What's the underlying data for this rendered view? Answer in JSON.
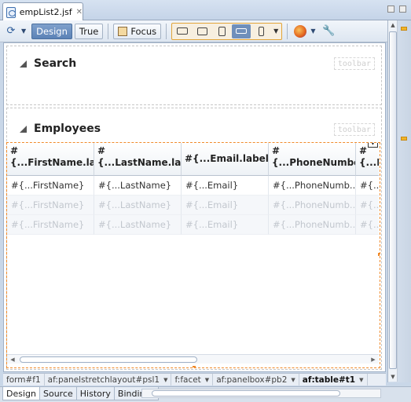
{
  "editor_tab": {
    "title": "empList2.jsf",
    "close_glyph": "✕"
  },
  "toolbar": {
    "design_label": "Design",
    "true_label": "True",
    "focus_label": "Focus",
    "dropdown_glyph": "▼",
    "selected_mode": "Design",
    "active_device": "wide-tablet"
  },
  "search_panel": {
    "title": "Search",
    "toolbar_placeholder": "toolbar"
  },
  "employees_panel": {
    "title": "Employees",
    "toolbar_placeholder": "toolbar"
  },
  "table": {
    "headers": [
      {
        "lines": [
          "#",
          "{...FirstName.label"
        ]
      },
      {
        "lines": [
          "#",
          "{...LastName.label"
        ]
      },
      {
        "lines": [
          "",
          "#{...Email.label}"
        ]
      },
      {
        "lines": [
          "#",
          "{...PhoneNumber"
        ]
      },
      {
        "lines": [
          "#",
          "{...H"
        ]
      }
    ],
    "rows": [
      [
        "#{...FirstName}",
        "#{...LastName}",
        "#{...Email}",
        "#{...PhoneNumb...",
        "#{...b"
      ],
      [
        "#{...FirstName}",
        "#{...LastName}",
        "#{...Email}",
        "#{...PhoneNumb...",
        "#{...b"
      ],
      [
        "#{...FirstName}",
        "#{...LastName}",
        "#{...Email}",
        "#{...PhoneNumb...",
        "#{...b"
      ]
    ],
    "column_menu_glyph": "▼"
  },
  "breadcrumb": [
    {
      "label": "form#f1",
      "current": false
    },
    {
      "label": "af:panelstretchlayout#psl1",
      "current": false
    },
    {
      "label": "f:facet",
      "current": false
    },
    {
      "label": "af:panelbox#pb2",
      "current": false
    },
    {
      "label": "af:table#t1",
      "current": true
    }
  ],
  "bottom_tabs": [
    "Design",
    "Source",
    "History",
    "Bindings"
  ],
  "colors": {
    "selection": "#f08a2a",
    "accent": "#5b82b6",
    "marker": "#f0b429"
  }
}
